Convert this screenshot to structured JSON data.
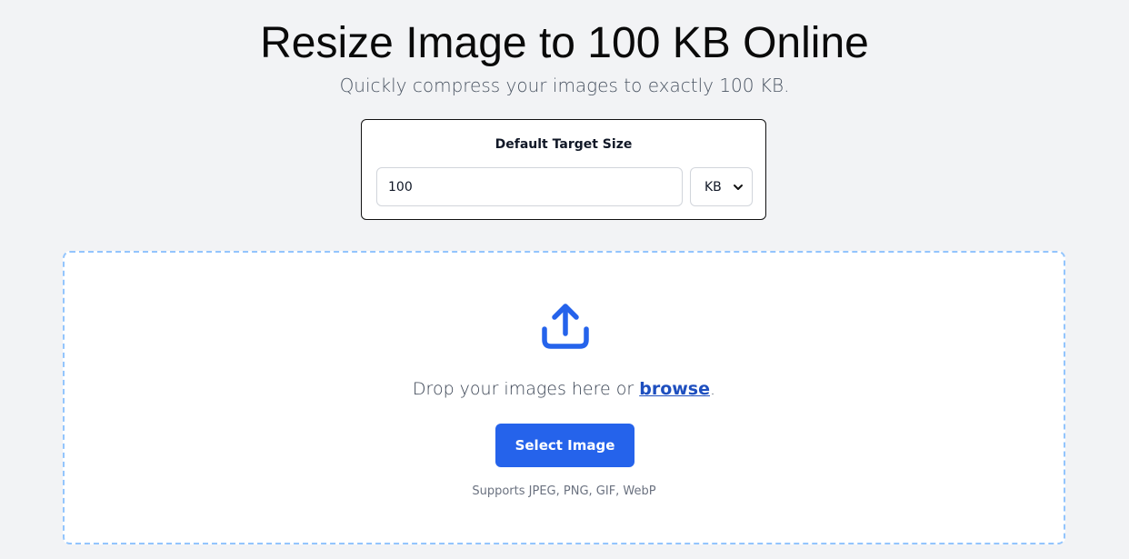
{
  "header": {
    "title": "Resize Image to 100 KB Online",
    "subtitle": "Quickly compress your images to exactly 100 KB."
  },
  "target_size": {
    "label": "Default Target Size",
    "value": "100",
    "unit_selected": "KB",
    "unit_options": [
      "KB"
    ]
  },
  "dropzone": {
    "icon": "upload-icon",
    "text_before": "Drop your images here or ",
    "browse_label": "browse",
    "text_after": ".",
    "button_label": "Select Image",
    "supports_text": "Supports JPEG, PNG, GIF, WebP"
  },
  "colors": {
    "background": "#f2f3f5",
    "accent": "#2563eb",
    "link": "#1e4fbf",
    "dropzone_border": "#93c5fd"
  }
}
